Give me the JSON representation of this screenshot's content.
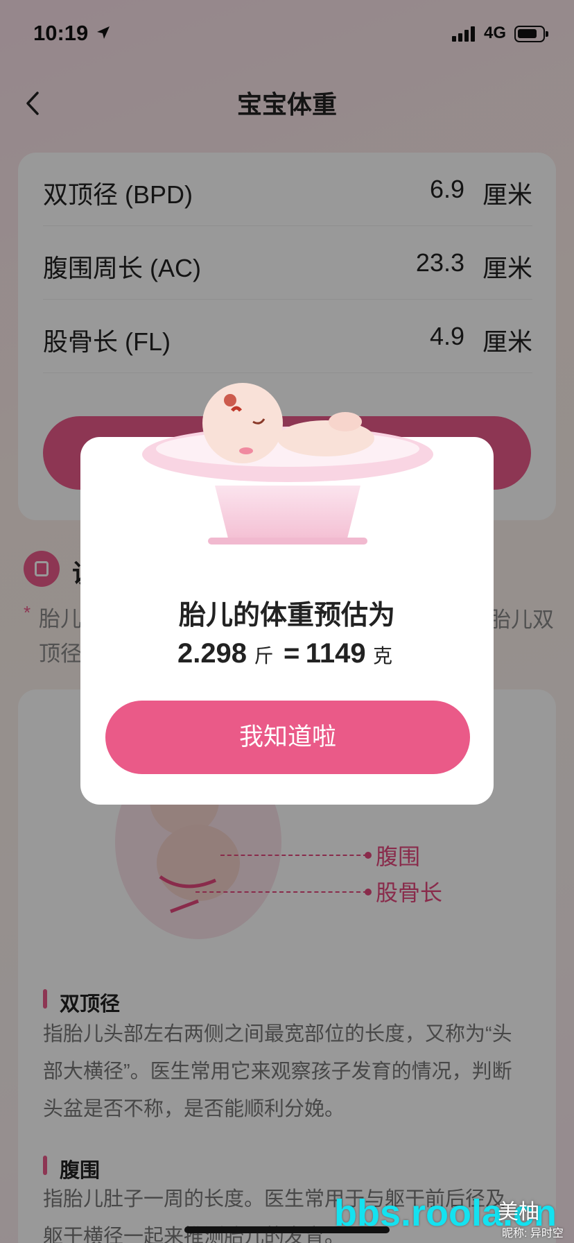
{
  "status_bar": {
    "time": "10:19",
    "network": "4G"
  },
  "nav": {
    "title": "宝宝体重"
  },
  "measurements": [
    {
      "label": "双顶径 (BPD)",
      "value": "6.9",
      "unit": "厘米"
    },
    {
      "label": "腹围周长 (AC)",
      "value": "23.3",
      "unit": "厘米"
    },
    {
      "label": "股骨长 (FL)",
      "value": "4.9",
      "unit": "厘米"
    }
  ],
  "section": {
    "title_visible": "说",
    "note_star": "*",
    "note_left": "胎儿 顶径",
    "note_right": "胎儿双"
  },
  "diagram": {
    "label_ac": "腹围",
    "label_fl": "股骨长"
  },
  "terms": [
    {
      "title": "双顶径",
      "desc": "指胎儿头部左右两侧之间最宽部位的长度，又称为“头部大横径”。医生常用它来观察孩子发育的情况，判断头盆是否不称，是否能顺利分娩。"
    },
    {
      "title": "腹围",
      "desc": "指胎儿肚子一周的长度。医生常用于与躯干前后径及躯干横径一起来推测胎儿的发育。"
    }
  ],
  "modal": {
    "title": "胎儿的体重预估为",
    "jin_value": "2.298",
    "jin_unit": "斤",
    "equals": "=",
    "gram_value": "1149",
    "gram_unit": "克",
    "ok_label": "我知道啦"
  },
  "watermark": {
    "main": "bbs.roola.cn",
    "logo": "美柚",
    "sub": "昵称: 异时空"
  },
  "colors": {
    "accent": "#ec5b8a",
    "overlay": "rgba(0,0,0,0.40)"
  }
}
